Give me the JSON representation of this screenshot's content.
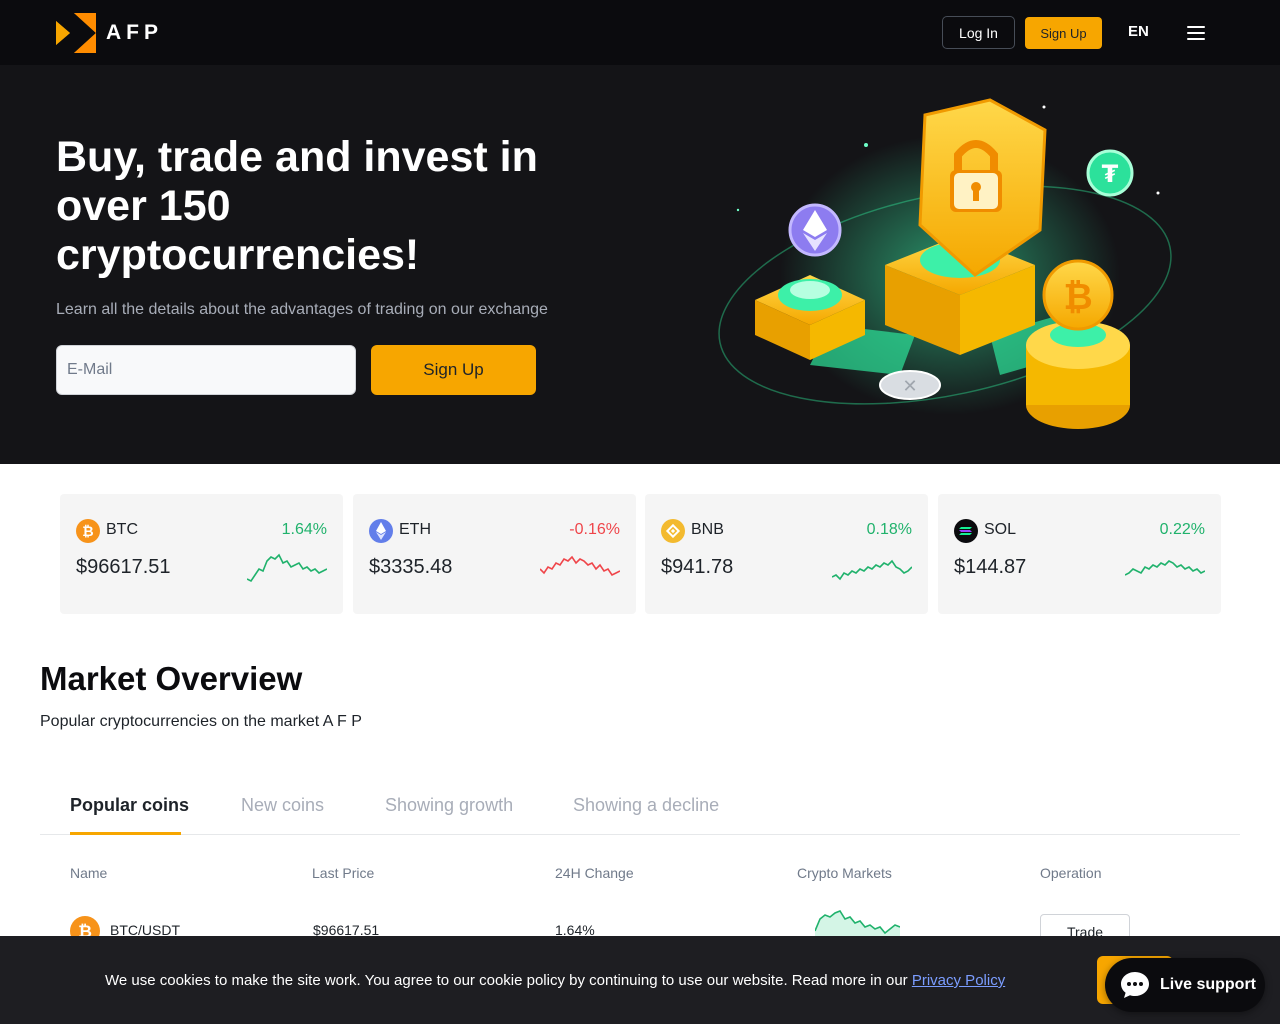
{
  "header": {
    "brand": "AFP",
    "login_label": "Log In",
    "signup_label": "Sign Up",
    "language": "EN",
    "menu_icon": "hamburger-menu-icon"
  },
  "hero": {
    "title": "Buy, trade and invest in over 150 cryptocurrencies!",
    "subtitle": "Learn all the details about the advantages of trading on our exchange",
    "email_placeholder": "E-Mail",
    "signup_label": "Sign Up",
    "illustration": "crypto-security-illustration"
  },
  "tickers": [
    {
      "symbol": "BTC",
      "change": "1.64%",
      "price": "$96617.51",
      "trend": "up",
      "icon": "btc-icon"
    },
    {
      "symbol": "ETH",
      "change": "-0.16%",
      "price": "$3335.48",
      "trend": "down",
      "icon": "eth-icon"
    },
    {
      "symbol": "BNB",
      "change": "0.18%",
      "price": "$941.78",
      "trend": "up",
      "icon": "bnb-icon"
    },
    {
      "symbol": "SOL",
      "change": "0.22%",
      "price": "$144.87",
      "trend": "up",
      "icon": "sol-icon"
    }
  ],
  "market": {
    "title": "Market Overview",
    "subtitle": "Popular cryptocurrencies on the market A F P",
    "tabs": [
      "Popular coins",
      "New coins",
      "Showing growth",
      "Showing a decline"
    ],
    "active_tab": "Popular coins",
    "columns": [
      "Name",
      "Last Price",
      "24H Change",
      "Crypto Markets",
      "Operation"
    ],
    "rows": [
      {
        "name": "BTC/USDT",
        "price": "$96617.51",
        "change": "1.64%",
        "trade_label": "Trade"
      }
    ]
  },
  "cookie": {
    "text": "We use cookies to make the site work. You agree to our cookie policy by continuing to use our website. Read more in our",
    "link_label": "Privacy Policy"
  },
  "support": {
    "label": "Live support"
  },
  "colors": {
    "accent": "#f7a600",
    "up": "#20b26c",
    "down": "#ef454a",
    "header_bg": "#0b0b0e",
    "hero_bg": "#141417"
  }
}
